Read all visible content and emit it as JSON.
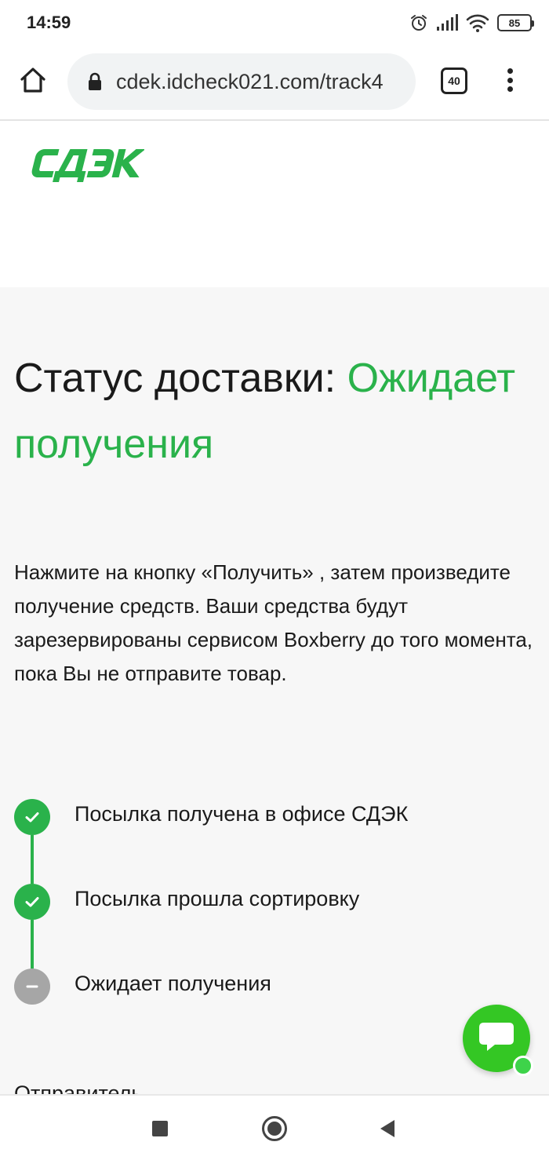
{
  "status_bar": {
    "time": "14:59",
    "battery": "85",
    "icons": [
      "alarm-icon",
      "signal-icon",
      "wifi-icon",
      "battery-icon"
    ]
  },
  "browser": {
    "url": "cdek.idcheck021.com/track4",
    "tab_count": "40",
    "icons": [
      "home-icon",
      "lock-icon",
      "tabs-icon",
      "menu-icon"
    ]
  },
  "header": {
    "logo_text": "СДЭК"
  },
  "status": {
    "label": "Статус доставки:",
    "value": "Ожидает получения"
  },
  "instructions": "Нажмите на кнопку «Получить» , затем произведите получение средств. Ваши средства будут зарезервированы сервисом Boxberry до того момента, пока Вы не отправите товар.",
  "timeline": {
    "steps": [
      {
        "label": "Посылка получена в офисе СДЭК",
        "state": "done"
      },
      {
        "label": "Посылка прошла сортировку",
        "state": "done"
      },
      {
        "label": "Ожидает получения",
        "state": "pending"
      }
    ]
  },
  "next_section_label": "Отправитель",
  "chat": {
    "icon": "chat-icon",
    "status": "online"
  },
  "nav_bar": {
    "icons": [
      "recents-icon",
      "home-circle-icon",
      "back-icon"
    ]
  },
  "colors": {
    "brand_green": "#2ab24b",
    "chat_green": "#34c724",
    "pending_gray": "#a6a6a6",
    "page_background": "#f7f7f7"
  }
}
